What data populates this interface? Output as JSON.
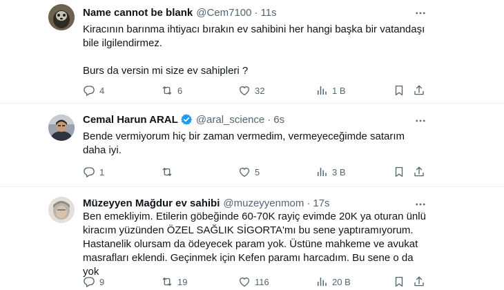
{
  "tweets": [
    {
      "name": "Name cannot be blank",
      "handle": "@Cem7100",
      "dot": "·",
      "time": "11s",
      "lines": [
        "Kiracının barınma ihtiyacı bırakın ev sahibini her hangi başka bir vatandaşı",
        "bile ilgilendirmez.",
        "",
        "Burs da versin mi size ev sahipleri ?"
      ],
      "replies": "4",
      "reposts": "6",
      "likes": "32",
      "views": "1 B",
      "verified": false
    },
    {
      "name": "Cemal Harun ARAL",
      "handle": "@aral_science",
      "dot": "·",
      "time": "6s",
      "lines": [
        "Bende vermiyorum hiç bir zaman vermedim, vermeyeceğimde satarım",
        "daha iyi."
      ],
      "replies": "1",
      "reposts": "",
      "likes": "5",
      "views": "3 B",
      "verified": true
    },
    {
      "name": "Müzeyyen Mağdur ev sahibi",
      "handle": "@muzeyyenmom",
      "dot": "·",
      "time": "17s",
      "lines": [
        "Ben emekliyim. Etilerin göbeğinde 60-70K rayiç evimde 20K ya oturan ünlü",
        "kiracım yüzünden ÖZEL SAĞLIK SİGORTA'mı bu sene yaptıramıyorum.",
        "Hastanelik olursam da ödeyecek param yok. Üstüne mahkeme ve avukat",
        "masrafları eklendi. Geçinmek için Kefen paramı harcadım. Bu sene o da yok"
      ],
      "replies": "9",
      "reposts": "19",
      "likes": "116",
      "views": "20 B",
      "verified": false
    }
  ],
  "colors": {
    "text": "#0f1419",
    "muted": "#536471",
    "verified": "#1d9bf0",
    "divider": "#eff3f4"
  },
  "icons": [
    "reply-icon",
    "repost-icon",
    "like-icon",
    "views-icon",
    "bookmark-icon",
    "share-icon",
    "more-icon",
    "verified-badge-icon"
  ]
}
